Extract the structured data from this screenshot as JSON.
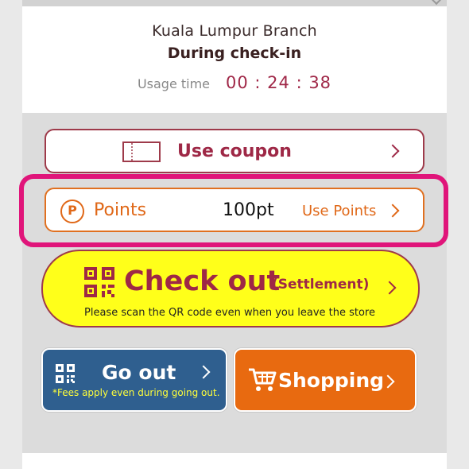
{
  "store": {
    "branch": "Kuala Lumpur Branch",
    "status": "During check-in",
    "usage_label": "Usage time",
    "usage_time": "00 : 24 : 38"
  },
  "coupon": {
    "label": "Use coupon",
    "icon": "ticket-icon"
  },
  "points": {
    "icon_letter": "P",
    "label": "Points",
    "value": "100pt",
    "action": "Use Points"
  },
  "checkout": {
    "label": "Check out",
    "sub_label": "(Settlement)",
    "note": "Please scan the QR code even when you leave the store",
    "icon": "qr-code-icon"
  },
  "go_out": {
    "label": "Go out",
    "note": "*Fees apply even during going out.",
    "icon": "qr-code-icon"
  },
  "shopping": {
    "label": "Shopping",
    "icon": "cart-icon"
  },
  "colors": {
    "maroon": "#9e2846",
    "orange": "#e06818",
    "highlight": "#e0157a",
    "yellow": "#ffff1a",
    "blue": "#2f5f8f",
    "shopping_orange": "#e86a10"
  }
}
